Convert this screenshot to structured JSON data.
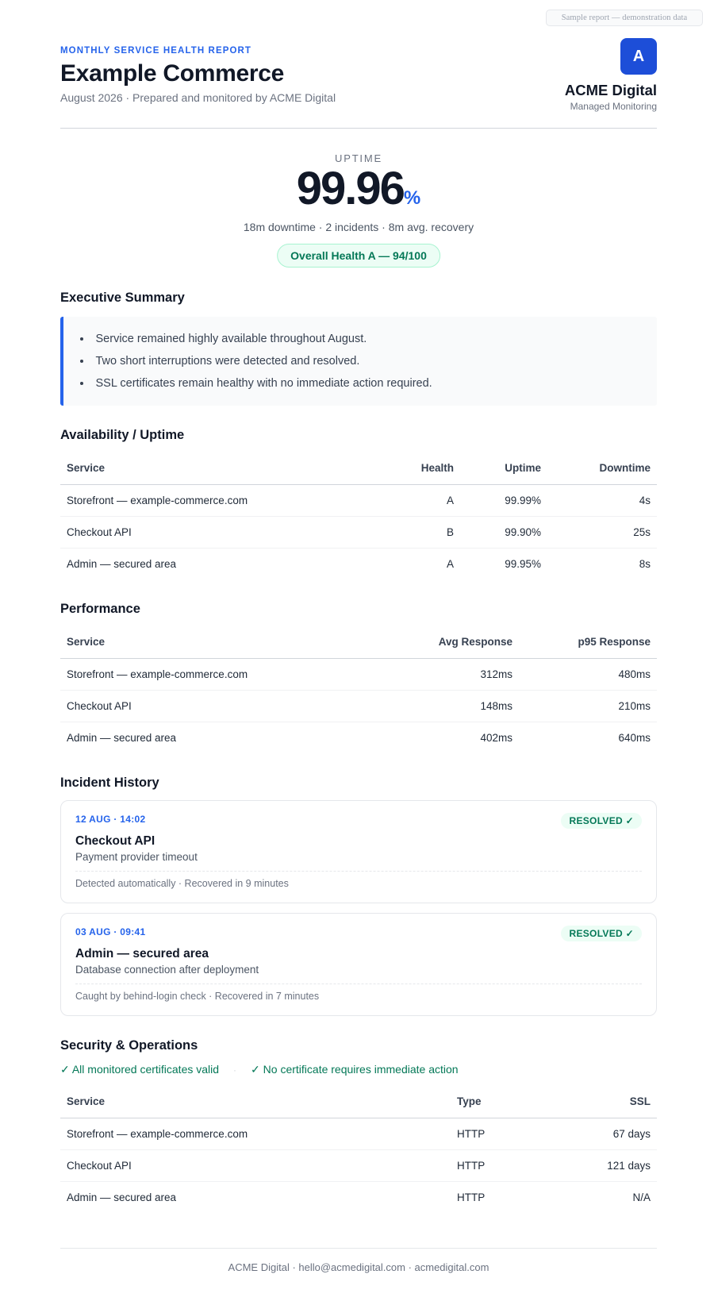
{
  "watermark": "Sample report — demonstration data",
  "header": {
    "kicker": "MONTHLY SERVICE HEALTH REPORT",
    "client": "Example Commerce",
    "subtitle": "August 2026 · Prepared and monitored by ACME Digital",
    "brand_initial": "A",
    "brand_name": "ACME Digital",
    "brand_tag": "Managed Monitoring"
  },
  "hero": {
    "label": "UPTIME",
    "value": "99.96",
    "unit": "%",
    "meta": "18m downtime · 2 incidents · 8m avg. recovery",
    "health": "Overall Health A — 94/100"
  },
  "summary": {
    "title": "Executive Summary",
    "items": [
      "Service remained highly available throughout August.",
      "Two short interruptions were detected and resolved.",
      "SSL certificates remain healthy with no immediate action required."
    ]
  },
  "availability": {
    "title": "Availability / Uptime",
    "headers": [
      "Service",
      "Health",
      "Uptime",
      "Downtime"
    ],
    "rows": [
      [
        "Storefront — example-commerce.com",
        "A",
        "99.99%",
        "4s"
      ],
      [
        "Checkout API",
        "B",
        "99.90%",
        "25s"
      ],
      [
        "Admin — secured area",
        "A",
        "99.95%",
        "8s"
      ]
    ]
  },
  "performance": {
    "title": "Performance",
    "headers": [
      "Service",
      "Avg Response",
      "p95 Response"
    ],
    "rows": [
      [
        "Storefront — example-commerce.com",
        "312ms",
        "480ms"
      ],
      [
        "Checkout API",
        "148ms",
        "210ms"
      ],
      [
        "Admin — secured area",
        "402ms",
        "640ms"
      ]
    ]
  },
  "incidents": {
    "title": "Incident History",
    "items": [
      {
        "time": "12 AUG · 14:02",
        "status": "RESOLVED ✓",
        "service": "Checkout API",
        "cause": "Payment provider timeout",
        "foot": "Detected automatically · Recovered in 9 minutes"
      },
      {
        "time": "03 AUG · 09:41",
        "status": "RESOLVED ✓",
        "service": "Admin — secured area",
        "cause": "Database connection after deployment",
        "foot": "Caught by behind-login check · Recovered in 7 minutes"
      }
    ]
  },
  "security": {
    "title": "Security & Operations",
    "check1": "✓ All monitored certificates valid",
    "separator": "·",
    "check2": "✓ No certificate requires immediate action",
    "headers": [
      "Service",
      "Type",
      "SSL"
    ],
    "rows": [
      [
        "Storefront — example-commerce.com",
        "HTTP",
        "67 days"
      ],
      [
        "Checkout API",
        "HTTP",
        "121 days"
      ],
      [
        "Admin — secured area",
        "HTTP",
        "N/A"
      ]
    ]
  },
  "footer": "ACME Digital · hello@acmedigital.com · acmedigital.com",
  "colors": {
    "accent": "#2563eb",
    "success": "#047857",
    "success_bg": "#ecfdf5",
    "text": "#111827",
    "muted": "#6b7280"
  }
}
